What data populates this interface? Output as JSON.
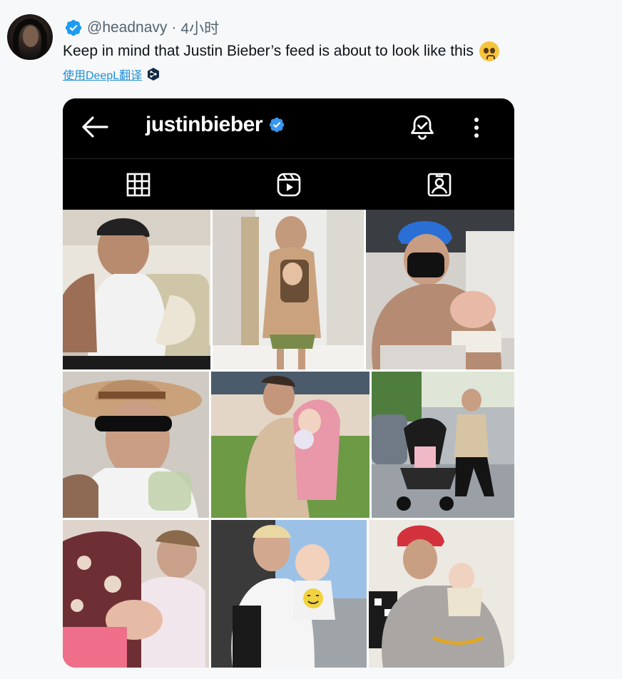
{
  "tweet": {
    "handle": "@headnavy",
    "separator": "·",
    "time": "4小时",
    "text": "Keep in mind that Justin Bieber’s feed is about to look like this",
    "emoji": "pleading-face-emoji",
    "translate_label": "使用DeepL翻译"
  },
  "instagram": {
    "username": "justinbieber",
    "tabs": [
      {
        "icon": "grid-icon",
        "active": true
      },
      {
        "icon": "reels-icon",
        "active": false
      },
      {
        "icon": "tagged-icon",
        "active": false
      }
    ],
    "posts": [
      {
        "name": "post-1",
        "subject": "man in black cap feeding baby on couch"
      },
      {
        "name": "post-2",
        "subject": "woman with baby carrier in store aisle"
      },
      {
        "name": "post-3",
        "subject": "man in blue cap and black mask holding newborn"
      },
      {
        "name": "post-4",
        "subject": "man in straw hat and sunglasses with drink"
      },
      {
        "name": "post-5",
        "subject": "man holding baby in pink hoodie"
      },
      {
        "name": "post-6",
        "subject": "man pushing stroller on street"
      },
      {
        "name": "post-7",
        "subject": "woman holding baby in hammock chair"
      },
      {
        "name": "post-8",
        "subject": "man holding baby in smiley shirt"
      },
      {
        "name": "post-9",
        "subject": "man in red cap holding baby on bed"
      }
    ]
  },
  "colors": {
    "handle_gray": "#536471",
    "verified_blue": "#1d9bf0",
    "link_blue": "#1d8fd8",
    "ig_black": "#000000"
  }
}
